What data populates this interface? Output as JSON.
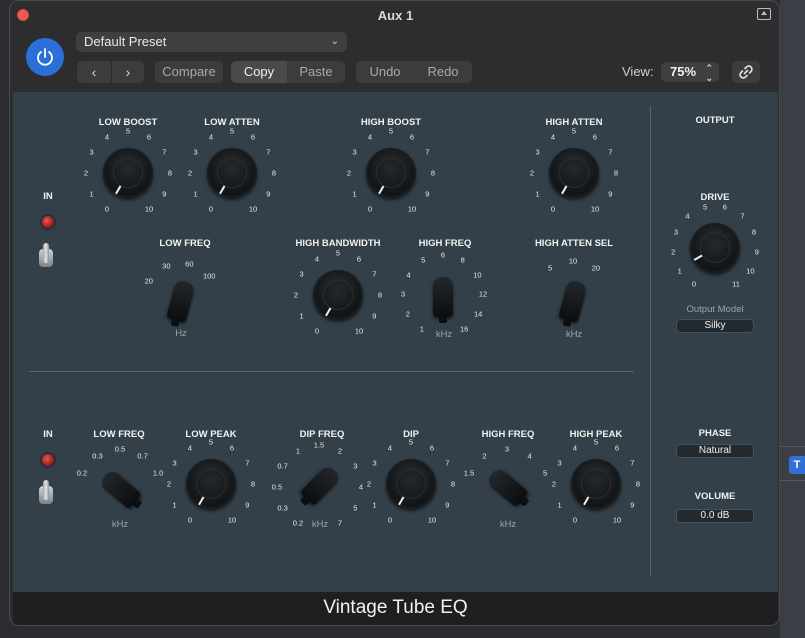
{
  "window": {
    "title": "Aux 1"
  },
  "header": {
    "preset": "Default Preset",
    "nav_back": "‹",
    "nav_forward": "›",
    "compare": "Compare",
    "copy": "Copy",
    "paste": "Paste",
    "undo": "Undo",
    "redo": "Redo",
    "view_label": "View:",
    "zoom": "75%",
    "accent_color": "#2b6fd9"
  },
  "plugin": {
    "name": "Vintage Tube EQ",
    "top_section": {
      "in_label": "IN",
      "low_boost": {
        "label": "LOW BOOST",
        "ticks": [
          "0",
          "1",
          "2",
          "3",
          "4",
          "5",
          "6",
          "7",
          "8",
          "9",
          "10"
        ]
      },
      "low_atten": {
        "label": "LOW ATTEN",
        "ticks": [
          "0",
          "1",
          "2",
          "3",
          "4",
          "5",
          "6",
          "7",
          "8",
          "9",
          "10"
        ]
      },
      "high_boost": {
        "label": "HIGH BOOST",
        "ticks": [
          "0",
          "1",
          "2",
          "3",
          "4",
          "5",
          "6",
          "7",
          "8",
          "9",
          "10"
        ]
      },
      "high_atten": {
        "label": "HIGH ATTEN",
        "ticks": [
          "0",
          "1",
          "2",
          "3",
          "4",
          "5",
          "6",
          "7",
          "8",
          "9",
          "10"
        ]
      },
      "low_freq": {
        "label": "LOW FREQ",
        "ticks": [
          "20",
          "30",
          "60",
          "100"
        ],
        "unit": "Hz"
      },
      "high_bandwidth": {
        "label": "HIGH BANDWIDTH",
        "ticks": [
          "0",
          "1",
          "2",
          "3",
          "4",
          "5",
          "6",
          "7",
          "8",
          "9",
          "10"
        ]
      },
      "high_freq": {
        "label": "HIGH FREQ",
        "ticks": [
          "1",
          "2",
          "3",
          "4",
          "5",
          "6",
          "8",
          "10",
          "12",
          "14",
          "16"
        ],
        "unit": "kHz"
      },
      "high_atten_sel": {
        "label": "HIGH ATTEN SEL",
        "ticks": [
          "5",
          "10",
          "20"
        ],
        "unit": "kHz"
      }
    },
    "bottom_section": {
      "in_label": "IN",
      "low_freq": {
        "label": "LOW FREQ",
        "ticks": [
          "0.2",
          "0.3",
          "0.5",
          "0.7",
          "1.0"
        ],
        "unit": "kHz"
      },
      "low_peak": {
        "label": "LOW PEAK",
        "ticks": [
          "0",
          "1",
          "2",
          "3",
          "4",
          "5",
          "6",
          "7",
          "8",
          "9",
          "10"
        ]
      },
      "dip_freq": {
        "label": "DIP FREQ",
        "ticks": [
          "0.2",
          "0.3",
          "0.5",
          "0.7",
          "1",
          "1.5",
          "2",
          "3",
          "4",
          "5",
          "7"
        ],
        "unit": "kHz"
      },
      "dip": {
        "label": "DIP",
        "ticks": [
          "0",
          "1",
          "2",
          "3",
          "4",
          "5",
          "6",
          "7",
          "8",
          "9",
          "10"
        ]
      },
      "high_freq": {
        "label": "HIGH FREQ",
        "ticks": [
          "1.5",
          "2",
          "3",
          "4",
          "5"
        ],
        "unit": "kHz"
      },
      "high_peak": {
        "label": "HIGH PEAK",
        "ticks": [
          "0",
          "1",
          "2",
          "3",
          "4",
          "5",
          "6",
          "7",
          "8",
          "9",
          "10"
        ]
      }
    },
    "output": {
      "title": "OUTPUT",
      "drive": {
        "label": "DRIVE",
        "ticks": [
          "0",
          "1",
          "2",
          "3",
          "4",
          "5",
          "6",
          "7",
          "8",
          "9",
          "10",
          "11"
        ]
      },
      "output_model_label": "Output Model",
      "output_model_value": "Silky",
      "phase_label": "PHASE",
      "phase_value": "Natural",
      "volume_label": "VOLUME",
      "volume_value": "0.0 dB"
    }
  }
}
